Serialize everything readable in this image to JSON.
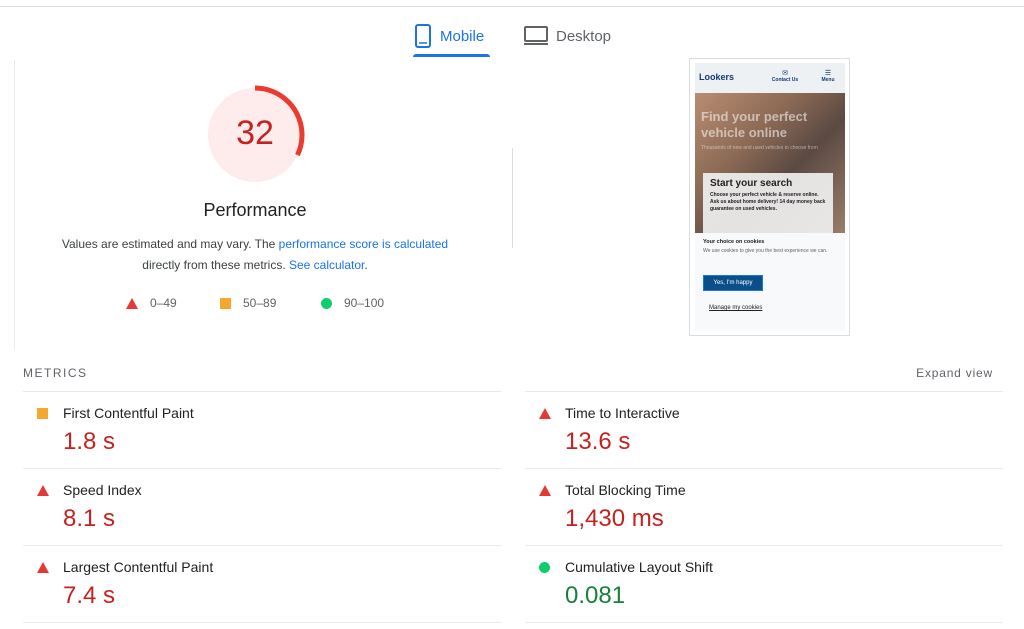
{
  "tabs": {
    "mobile": "Mobile",
    "desktop": "Desktop",
    "active": "mobile"
  },
  "performance": {
    "score": "32",
    "score_fraction": 0.32,
    "title": "Performance",
    "note_prefix": "Values are estimated and may vary. The ",
    "note_link1": "performance score is calculated",
    "note_middle": "directly from these metrics. ",
    "note_link2": "See calculator",
    "note_suffix": ".",
    "color": "#c5221f"
  },
  "legend": [
    {
      "label": "0–49",
      "shape": "triangle",
      "color": "#e53935"
    },
    {
      "label": "50–89",
      "shape": "square",
      "color": "#f4a830"
    },
    {
      "label": "90–100",
      "shape": "circle",
      "color": "#0cce6b"
    }
  ],
  "screenshot": {
    "logo": "Lookers",
    "contact": "Contact Us",
    "menu": "Menu",
    "hero_title": "Find your perfect vehicle online",
    "hero_sub": "Thousands of new and used vehicles to choose from",
    "card_title": "Start your search",
    "card_text": "Choose your perfect vehicle & reserve online. Ask us about home delivery! 14 day money back guarantee on used vehicles.",
    "cookie_title": "Your choice on cookies",
    "cookie_text": "We use cookies to give you the best experience we can.",
    "cookie_button": "Yes, I'm happy",
    "cookie_link": "Manage my cookies"
  },
  "metrics": {
    "label": "METRICS",
    "expand": "Expand view",
    "items": [
      {
        "name": "First Contentful Paint",
        "value": "1.8 s",
        "rating": "average"
      },
      {
        "name": "Time to Interactive",
        "value": "13.6 s",
        "rating": "fail"
      },
      {
        "name": "Speed Index",
        "value": "8.1 s",
        "rating": "fail"
      },
      {
        "name": "Total Blocking Time",
        "value": "1,430 ms",
        "rating": "fail"
      },
      {
        "name": "Largest Contentful Paint",
        "value": "7.4 s",
        "rating": "fail"
      },
      {
        "name": "Cumulative Layout Shift",
        "value": "0.081",
        "rating": "pass"
      }
    ]
  }
}
